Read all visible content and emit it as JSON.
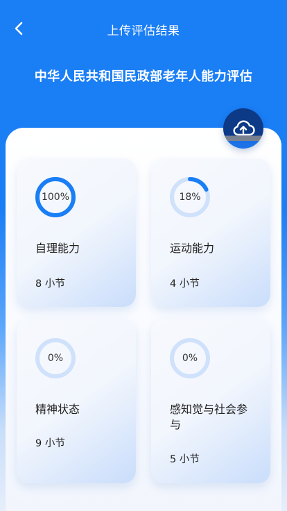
{
  "header": {
    "back_icon": "chevron-left-icon",
    "title": "上传评估结果",
    "page_title": "中华人民共和国民政部老年人能力评估"
  },
  "upload": {
    "icon": "cloud-upload-icon"
  },
  "colors": {
    "brand": "#1a7ef5",
    "ring_active": "#1a7ef5",
    "ring_track": "#cfe1fb"
  },
  "cards": [
    {
      "progress_label": "100%",
      "progress": 1.0,
      "name": "自理能力",
      "count": "8 小节"
    },
    {
      "progress_label": "18%",
      "progress": 0.18,
      "name": "运动能力",
      "count": "4 小节"
    },
    {
      "progress_label": "0%",
      "progress": 0.0,
      "name": "精神状态",
      "count": "9 小节"
    },
    {
      "progress_label": "0%",
      "progress": 0.0,
      "name": "感知觉与社会参与",
      "count": "5 小节"
    }
  ]
}
